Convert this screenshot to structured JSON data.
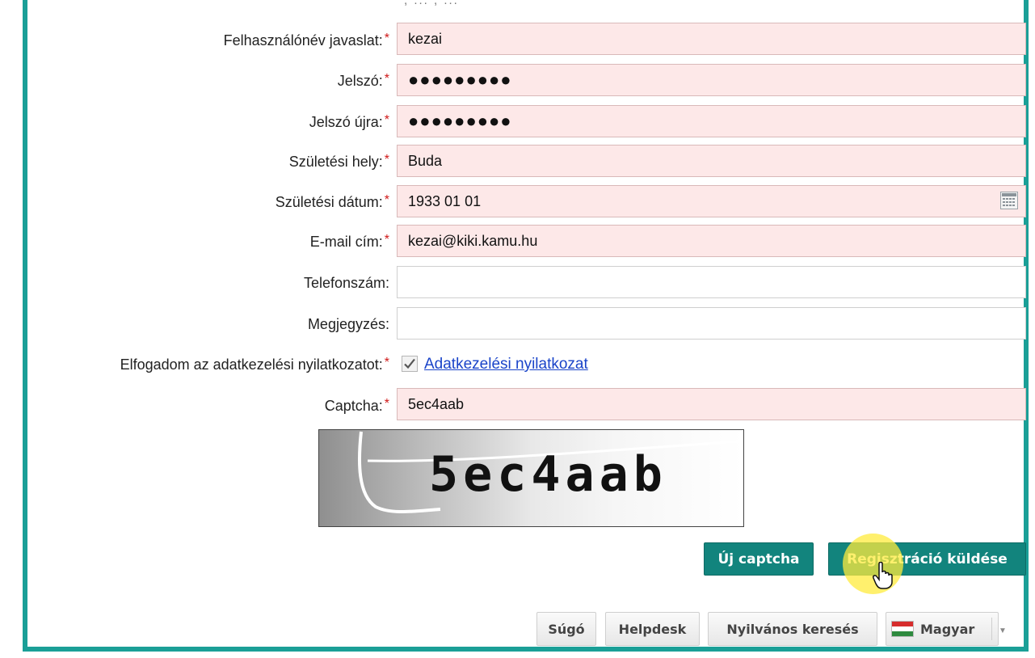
{
  "form": {
    "cut_text": ",  ...  ,  ... ",
    "required_mark": "*",
    "username": {
      "label": "Felhasználónév javaslat:",
      "value": "kezai"
    },
    "password": {
      "label": "Jelszó:",
      "value": "●●●●●●●●●"
    },
    "password_again": {
      "label": "Jelszó újra:",
      "value": "●●●●●●●●●"
    },
    "birth_place": {
      "label": "Születési hely:",
      "value": "Buda"
    },
    "birth_date": {
      "label": "Születési dátum:",
      "value": "1933 01 01"
    },
    "email": {
      "label": "E-mail cím:",
      "value": "kezai@kiki.kamu.hu"
    },
    "phone": {
      "label": "Telefonszám:",
      "value": ""
    },
    "note": {
      "label": "Megjegyzés:",
      "value": ""
    },
    "consent": {
      "label": "Elfogadom az adatkezelési nyilatkozatot:",
      "checked": true,
      "link_text": "Adatkezelési nyilatkozat"
    },
    "captcha": {
      "label": "Captcha:",
      "value": "5ec4aab",
      "image_text": "5ec4aab"
    }
  },
  "buttons": {
    "new_captcha": "Új captcha",
    "submit": "Regisztráció küldése"
  },
  "footer": {
    "help": "Súgó",
    "helpdesk": "Helpdesk",
    "public_search": "Nyilvános keresés",
    "language": "Magyar"
  },
  "colors": {
    "frame": "#1a9f97",
    "button": "#12847d",
    "required_field_bg": "#fde8e8",
    "required_mark": "#d01818",
    "link": "#1a44c9"
  },
  "icons": {
    "calendar": "calendar-icon",
    "checkmark": "checkmark-icon",
    "cursor": "hand-pointer-icon",
    "flag": "hungarian-flag-icon",
    "dropdown": "chevron-down-icon"
  }
}
